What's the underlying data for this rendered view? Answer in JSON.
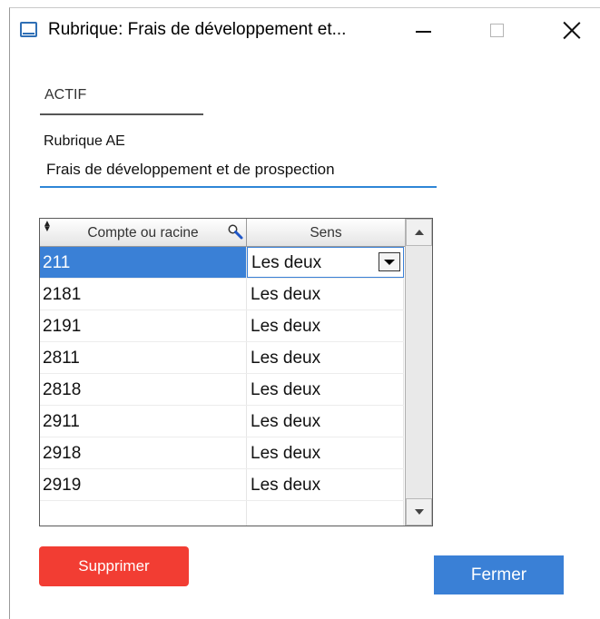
{
  "window": {
    "title": "Rubrique: Frais de développement et...",
    "icon": "window-app-icon",
    "controls": [
      "minimize-icon",
      "maximize-icon",
      "close-icon"
    ]
  },
  "form": {
    "section_label": "ACTIF",
    "field_label": "Rubrique AE",
    "field_value": "Frais de développement et de prospection"
  },
  "grid": {
    "columns": [
      "Compte ou racine",
      "Sens"
    ],
    "header_icons": [
      "sort-icon",
      "search-icon"
    ],
    "rows": [
      {
        "compte": "211",
        "sens": "Les deux"
      },
      {
        "compte": "2181",
        "sens": "Les deux"
      },
      {
        "compte": "2191",
        "sens": "Les deux"
      },
      {
        "compte": "2811",
        "sens": "Les deux"
      },
      {
        "compte": "2818",
        "sens": "Les deux"
      },
      {
        "compte": "2911",
        "sens": "Les deux"
      },
      {
        "compte": "2918",
        "sens": "Les deux"
      },
      {
        "compte": "2919",
        "sens": "Les deux"
      },
      {
        "compte": "",
        "sens": ""
      }
    ],
    "selected_row": 0
  },
  "buttons": {
    "delete_label": "Supprimer",
    "close_label": "Fermer"
  },
  "colors": {
    "accent": "#3a80d6",
    "danger": "#f23d33",
    "input_underline": "#2e86d6"
  }
}
